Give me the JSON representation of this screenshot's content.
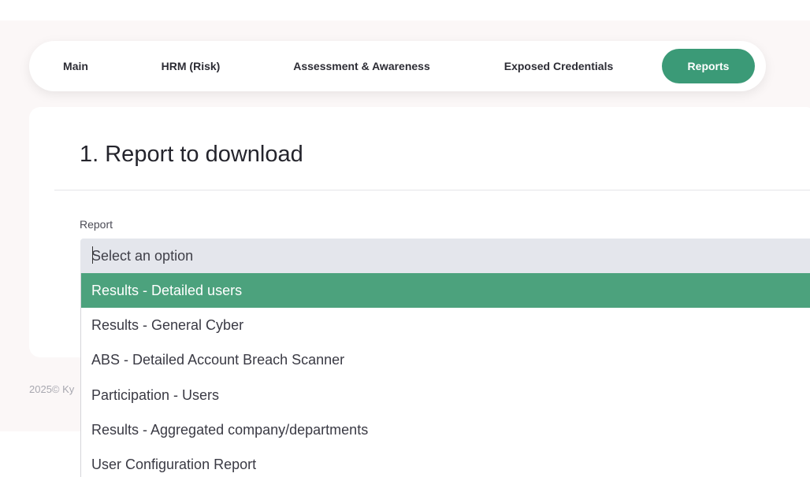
{
  "nav": {
    "tabs": [
      {
        "label": "Main"
      },
      {
        "label": "HRM (Risk)"
      },
      {
        "label": "Assessment & Awareness"
      },
      {
        "label": "Exposed Credentials"
      },
      {
        "label": "Reports",
        "active": true
      }
    ]
  },
  "section": {
    "title": "1. Report to download"
  },
  "report_field": {
    "label": "Report",
    "placeholder": "Select an option",
    "options": [
      "Results - Detailed users",
      "Results - General Cyber",
      "ABS - Detailed Account Breach Scanner",
      "Participation - Users",
      "Results - Aggregated company/departments",
      "User Configuration Report"
    ],
    "highlighted_index": 0
  },
  "footer": {
    "text": "2025© Ky"
  },
  "colors": {
    "accent": "#3b9a77",
    "highlight": "#4ca27d"
  }
}
